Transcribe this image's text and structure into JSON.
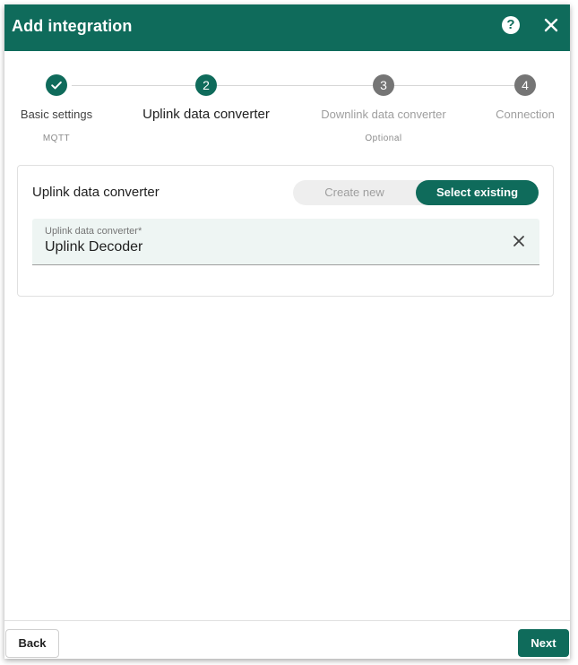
{
  "dialog": {
    "title": "Add integration",
    "help_glyph": "?",
    "icons": {
      "help": "help-circle-icon",
      "close": "close-icon"
    }
  },
  "stepper": {
    "steps": [
      {
        "index": "1",
        "label": "Basic settings",
        "sublabel": "MQTT",
        "state": "completed"
      },
      {
        "index": "2",
        "label": "Uplink data converter",
        "sublabel": "",
        "state": "current"
      },
      {
        "index": "3",
        "label": "Downlink data converter",
        "sublabel": "Optional",
        "state": "pending"
      },
      {
        "index": "4",
        "label": "Connection",
        "sublabel": "",
        "state": "pending"
      }
    ]
  },
  "converter": {
    "title": "Uplink data converter",
    "toggle": {
      "create_new": "Create new",
      "select_existing": "Select existing",
      "selected": "select_existing"
    },
    "field": {
      "label": "Uplink data converter*",
      "value": "Uplink Decoder"
    }
  },
  "footer": {
    "back_label": "Back",
    "next_label": "Next"
  },
  "colors": {
    "primary": "#0f6b5b",
    "pending_step": "#757575",
    "field_bg": "#eef5f3"
  }
}
